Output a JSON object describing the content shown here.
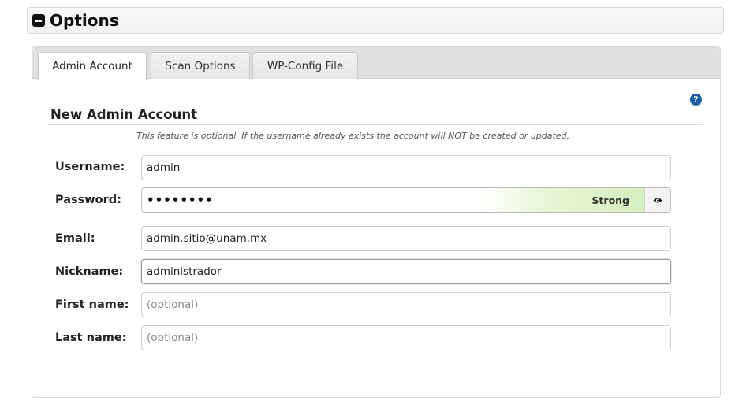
{
  "header": {
    "title": "Options",
    "collapse_icon": "minus-square-icon"
  },
  "tabs": [
    {
      "label": "Admin Account",
      "active": true
    },
    {
      "label": "Scan Options",
      "active": false
    },
    {
      "label": "WP-Config File",
      "active": false
    }
  ],
  "section": {
    "title": "New Admin Account",
    "note": "This feature is optional. If the username already exists the account will NOT be created or updated.",
    "help_icon": "question-circle-icon"
  },
  "form": {
    "username": {
      "label": "Username:",
      "value": "admin"
    },
    "password": {
      "label": "Password:",
      "value": "••••••••",
      "strength": "Strong",
      "toggle_icon": "eye-icon"
    },
    "email": {
      "label": "Email:",
      "value": "admin.sitio@unam.mx"
    },
    "nickname": {
      "label": "Nickname:",
      "value": "administrador"
    },
    "first_name": {
      "label": "First name:",
      "value": "",
      "placeholder": "(optional)"
    },
    "last_name": {
      "label": "Last name:",
      "value": "",
      "placeholder": "(optional)"
    }
  },
  "colors": {
    "help_icon": "#1a5fa6",
    "strength_meter": "#d5efbd"
  }
}
